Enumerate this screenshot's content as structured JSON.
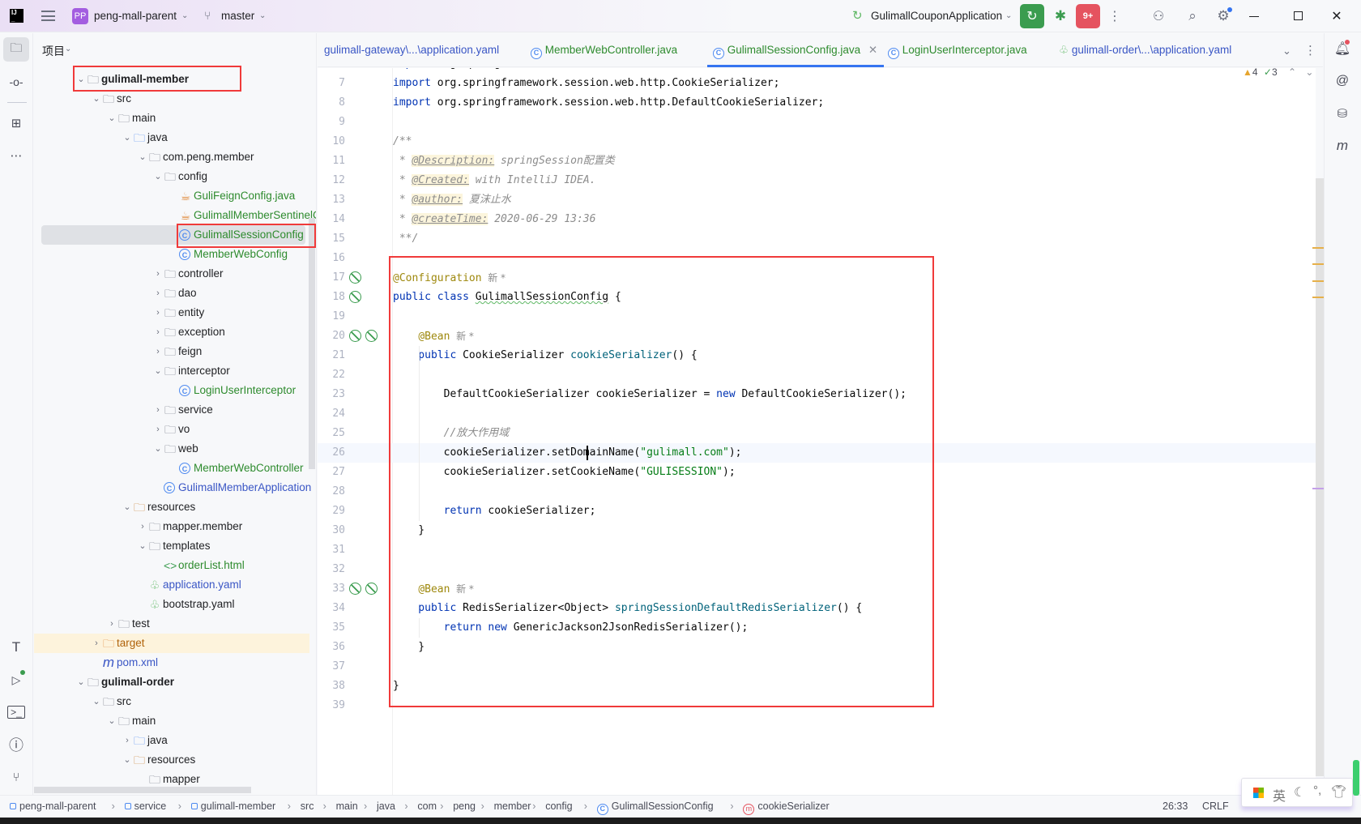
{
  "titlebar": {
    "project_badge": "PP",
    "project": "peng-mall-parent",
    "branch": "master",
    "run_config": "GulimallCouponApplication",
    "notif_badge": "9+"
  },
  "colors": {
    "accent": "#3574f0",
    "run_green": "#3b9c4f",
    "stop_red": "#e5535f",
    "keyword": "#0033b3",
    "annotation": "#9e880d",
    "string": "#067d17"
  },
  "project_panel": {
    "title": "项目"
  },
  "tree": [
    {
      "d": 0,
      "label": "gulimall-member",
      "icon": "module-folder",
      "exp": true,
      "bold": true
    },
    {
      "d": 1,
      "label": "src",
      "icon": "folder",
      "exp": true
    },
    {
      "d": 2,
      "label": "main",
      "icon": "folder",
      "exp": true
    },
    {
      "d": 3,
      "label": "java",
      "icon": "source-folder",
      "exp": true
    },
    {
      "d": 4,
      "label": "com.peng.member",
      "icon": "package",
      "exp": true
    },
    {
      "d": 5,
      "label": "config",
      "icon": "package",
      "exp": true
    },
    {
      "d": 6,
      "label": "GuliFeignConfig.java",
      "icon": "java-file",
      "color": "#2e8b2e"
    },
    {
      "d": 6,
      "label": "GulimallMemberSentinelConfig",
      "icon": "java-file",
      "color": "#2e8b2e"
    },
    {
      "d": 6,
      "label": "GulimallSessionConfig",
      "icon": "class",
      "color": "#2e8b2e",
      "selected": true
    },
    {
      "d": 6,
      "label": "MemberWebConfig",
      "icon": "class",
      "color": "#2e8b2e"
    },
    {
      "d": 5,
      "label": "controller",
      "icon": "package",
      "exp": false
    },
    {
      "d": 5,
      "label": "dao",
      "icon": "package",
      "exp": false
    },
    {
      "d": 5,
      "label": "entity",
      "icon": "package",
      "exp": false
    },
    {
      "d": 5,
      "label": "exception",
      "icon": "package",
      "exp": false
    },
    {
      "d": 5,
      "label": "feign",
      "icon": "package",
      "exp": false
    },
    {
      "d": 5,
      "label": "interceptor",
      "icon": "package",
      "exp": true
    },
    {
      "d": 6,
      "label": "LoginUserInterceptor",
      "icon": "class",
      "color": "#2e8b2e"
    },
    {
      "d": 5,
      "label": "service",
      "icon": "package",
      "exp": false
    },
    {
      "d": 5,
      "label": "vo",
      "icon": "package",
      "exp": false
    },
    {
      "d": 5,
      "label": "web",
      "icon": "package",
      "exp": true
    },
    {
      "d": 6,
      "label": "MemberWebController",
      "icon": "class",
      "color": "#2e8b2e"
    },
    {
      "d": 5,
      "label": "GulimallMemberApplication",
      "icon": "spring-boot-class",
      "color": "#3a56c5"
    },
    {
      "d": 3,
      "label": "resources",
      "icon": "resources-folder",
      "exp": true
    },
    {
      "d": 4,
      "label": "mapper.member",
      "icon": "folder",
      "exp": false
    },
    {
      "d": 4,
      "label": "templates",
      "icon": "folder",
      "exp": true
    },
    {
      "d": 5,
      "label": "orderList.html",
      "icon": "html-file",
      "color": "#2e8b2e"
    },
    {
      "d": 4,
      "label": "application.yaml",
      "icon": "spring-yaml",
      "color": "#3a56c5"
    },
    {
      "d": 4,
      "label": "bootstrap.yaml",
      "icon": "spring-yaml"
    },
    {
      "d": 2,
      "label": "test",
      "icon": "folder",
      "exp": false
    },
    {
      "d": 1,
      "label": "target",
      "icon": "excluded-folder",
      "exp": false,
      "color": "#b0630b",
      "highlight": true
    },
    {
      "d": 1,
      "label": "pom.xml",
      "icon": "maven-file",
      "color": "#3a56c5"
    },
    {
      "d": 0,
      "label": "gulimall-order",
      "icon": "module-folder",
      "exp": true,
      "bold": true
    },
    {
      "d": 1,
      "label": "src",
      "icon": "folder",
      "exp": true
    },
    {
      "d": 2,
      "label": "main",
      "icon": "folder",
      "exp": true
    },
    {
      "d": 3,
      "label": "java",
      "icon": "source-folder",
      "exp": false
    },
    {
      "d": 3,
      "label": "resources",
      "icon": "resources-folder",
      "exp": true
    },
    {
      "d": 4,
      "label": "mapper",
      "icon": "folder"
    }
  ],
  "tabs": [
    {
      "label": "gulimall-gateway\\...\\application.yaml",
      "icon": "none",
      "color": "#3a56c5"
    },
    {
      "label": "MemberWebController.java",
      "icon": "class",
      "color": "#2e8b2e"
    },
    {
      "label": "GulimallSessionConfig.java",
      "icon": "class",
      "color": "#2e8b2e",
      "active": true
    },
    {
      "label": "LoginUserInterceptor.java",
      "icon": "class",
      "color": "#2e8b2e"
    },
    {
      "label": "gulimall-order\\...\\application.yaml",
      "icon": "spring-yaml",
      "color": "#3a56c5"
    }
  ],
  "inspections": {
    "warnings": "4",
    "ok": "3"
  },
  "code": [
    {
      "n": "6",
      "t": [
        [
          "import",
          "kw"
        ],
        [
          " org.springframework.data.redis.serializer.RedisSerializer;",
          "pl"
        ]
      ]
    },
    {
      "n": "7",
      "t": [
        [
          "import",
          "kw"
        ],
        [
          " org.springframework.session.web.http.CookieSerializer;",
          "pl"
        ]
      ]
    },
    {
      "n": "8",
      "t": [
        [
          "import",
          "kw"
        ],
        [
          " org.springframework.session.web.http.DefaultCookieSerializer;",
          "pl"
        ]
      ]
    },
    {
      "n": "9",
      "t": []
    },
    {
      "n": "10",
      "t": [
        [
          "/**",
          "cm"
        ]
      ]
    },
    {
      "n": "11",
      "t": [
        [
          " * ",
          "cm"
        ],
        [
          "@Description:",
          "tag"
        ],
        [
          " springSession配置类",
          "cm"
        ]
      ]
    },
    {
      "n": "12",
      "t": [
        [
          " * ",
          "cm"
        ],
        [
          "@Created:",
          "tag"
        ],
        [
          " with IntelliJ IDEA.",
          "cm"
        ]
      ]
    },
    {
      "n": "13",
      "t": [
        [
          " * ",
          "cm"
        ],
        [
          "@author:",
          "tag"
        ],
        [
          " 夏沫止水",
          "cm"
        ]
      ]
    },
    {
      "n": "14",
      "t": [
        [
          " * ",
          "cm"
        ],
        [
          "@createTime:",
          "tag"
        ],
        [
          " 2020-06-29 13:36",
          "cm"
        ]
      ]
    },
    {
      "n": "15",
      "t": [
        [
          " **/",
          "cm"
        ]
      ]
    },
    {
      "n": "16",
      "t": []
    },
    {
      "n": "17",
      "g": 1,
      "t": [
        [
          "@Configuration",
          "ann"
        ],
        [
          "  新 *",
          "hint"
        ]
      ]
    },
    {
      "n": "18",
      "g": 1,
      "t": [
        [
          "public class ",
          "kw"
        ],
        [
          "GulimallSessionConfig",
          "pl squig"
        ],
        [
          " {",
          "pl"
        ]
      ]
    },
    {
      "n": "19",
      "t": []
    },
    {
      "n": "20",
      "g": 2,
      "t": [
        [
          "    ",
          "pl"
        ],
        [
          "@Bean",
          "ann"
        ],
        [
          "  新 *",
          "hint"
        ]
      ]
    },
    {
      "n": "21",
      "t": [
        [
          "    public ",
          "kw"
        ],
        [
          "CookieSerializer ",
          "pl"
        ],
        [
          "cookieSerializer",
          "fn"
        ],
        [
          "() {",
          "pl"
        ]
      ]
    },
    {
      "n": "22",
      "t": []
    },
    {
      "n": "23",
      "t": [
        [
          "        DefaultCookieSerializer cookieSerializer = ",
          "pl"
        ],
        [
          "new ",
          "kw"
        ],
        [
          "DefaultCookieSerializer();",
          "pl"
        ]
      ]
    },
    {
      "n": "24",
      "t": []
    },
    {
      "n": "25",
      "t": [
        [
          "        //放大作用域",
          "cm"
        ]
      ]
    },
    {
      "n": "26",
      "cur": true,
      "t": [
        [
          "        cookieSerializer.setDomainName(",
          "pl"
        ],
        [
          "\"gulimall.com\"",
          "str"
        ],
        [
          ");",
          "pl"
        ]
      ]
    },
    {
      "n": "27",
      "t": [
        [
          "        cookieSerializer.setCookieName(",
          "pl"
        ],
        [
          "\"GULISESSION\"",
          "str"
        ],
        [
          ");",
          "pl"
        ]
      ]
    },
    {
      "n": "28",
      "t": []
    },
    {
      "n": "29",
      "t": [
        [
          "        return ",
          "kw"
        ],
        [
          "cookieSerializer;",
          "pl"
        ]
      ]
    },
    {
      "n": "30",
      "t": [
        [
          "    }",
          "pl"
        ]
      ]
    },
    {
      "n": "31",
      "t": []
    },
    {
      "n": "32",
      "t": []
    },
    {
      "n": "33",
      "g": 2,
      "t": [
        [
          "    ",
          "pl"
        ],
        [
          "@Bean",
          "ann"
        ],
        [
          "  新 *",
          "hint"
        ]
      ]
    },
    {
      "n": "34",
      "t": [
        [
          "    public ",
          "kw"
        ],
        [
          "RedisSerializer<Object> ",
          "pl"
        ],
        [
          "springSessionDefaultRedisSerializer",
          "fn"
        ],
        [
          "() {",
          "pl"
        ]
      ]
    },
    {
      "n": "35",
      "t": [
        [
          "        return new ",
          "kw"
        ],
        [
          "GenericJackson2JsonRedisSerializer();",
          "pl"
        ]
      ]
    },
    {
      "n": "36",
      "t": [
        [
          "    }",
          "pl"
        ]
      ]
    },
    {
      "n": "37",
      "t": []
    },
    {
      "n": "38",
      "t": [
        [
          "}",
          "pl"
        ]
      ]
    },
    {
      "n": "39",
      "t": []
    }
  ],
  "status": {
    "breadcrumbs": [
      "peng-mall-parent",
      "service",
      "gulimall-member",
      "src",
      "main",
      "java",
      "com",
      "peng",
      "member",
      "config",
      "GulimallSessionConfig",
      "cookieSerializer"
    ],
    "position": "26:33",
    "line_sep": "CRLF"
  },
  "ime": {
    "label": "英"
  }
}
